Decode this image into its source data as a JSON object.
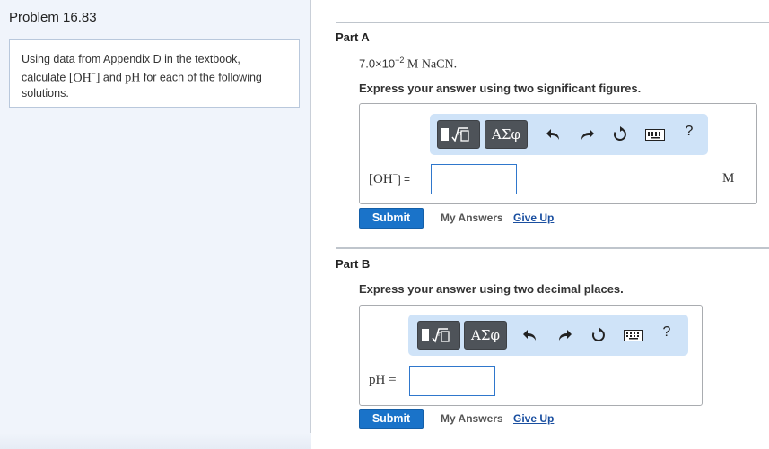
{
  "problem": {
    "title": "Problem 16.83",
    "text_line1": "Using data from Appendix D in the textbook,",
    "text_line2_pre": "calculate ",
    "text_line2_oh": "[OH",
    "text_line2_oh_sup": "−",
    "text_line2_oh_close": "]",
    "text_line2_mid": " and ",
    "text_line2_ph": "pH",
    "text_line2_post": " for each of the following",
    "text_line3": "solutions."
  },
  "part_a": {
    "label": "Part A",
    "concentration": "7.0×10",
    "concentration_exp": "−2",
    "concentration_unit": " M NaCN.",
    "instruction": "Express your answer using two significant figures.",
    "variable": "[OH",
    "variable_sup": "−",
    "variable_close": "] =",
    "input_value": "",
    "unit": "M",
    "submit_label": "Submit",
    "my_answers_label": "My Answers",
    "give_up_label": "Give Up"
  },
  "part_b": {
    "label": "Part B",
    "instruction": "Express your answer using two decimal places.",
    "variable": "pH =",
    "input_value": "",
    "submit_label": "Submit",
    "my_answers_label": "My Answers",
    "give_up_label": "Give Up"
  },
  "toolbar": {
    "greek_label": "ΑΣφ",
    "help_label": "?",
    "icons": [
      "templates-icon",
      "greek-icon",
      "undo-icon",
      "redo-icon",
      "reset-icon",
      "keyboard-icon",
      "help-icon"
    ]
  }
}
